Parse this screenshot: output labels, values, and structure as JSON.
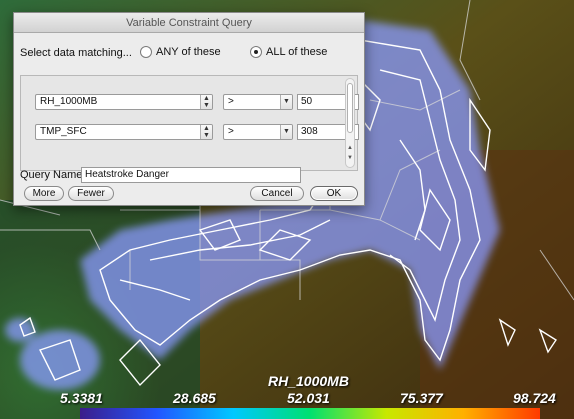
{
  "dialog": {
    "title": "Variable Constraint Query",
    "match_label": "Select data matching...",
    "match_options": [
      {
        "label": "ANY of these",
        "selected": false
      },
      {
        "label": "ALL of these",
        "selected": true
      }
    ],
    "rules": [
      {
        "variable": "RH_1000MB",
        "operator": ">",
        "value": "50"
      },
      {
        "variable": "TMP_SFC",
        "operator": ">",
        "value": "308"
      }
    ],
    "query_name_label": "Query Name:",
    "query_name_value": "Heatstroke Danger",
    "buttons": {
      "more": "More",
      "fewer": "Fewer",
      "cancel": "Cancel",
      "ok": "OK"
    }
  },
  "colorbar": {
    "title": "RH_1000MB",
    "tick_labels": [
      "5.3381",
      "28.685",
      "52.031",
      "75.377",
      "98.724"
    ],
    "gradient": [
      "#3b1d8a",
      "#2255ff",
      "#00c8ff",
      "#00e070",
      "#c8e800",
      "#ffb000",
      "#ff3a00"
    ]
  },
  "colors": {
    "contour": "#ffffff",
    "glow": "#8a9aff",
    "land_low": "#1f6b3a",
    "land_high": "#6a3a10"
  }
}
